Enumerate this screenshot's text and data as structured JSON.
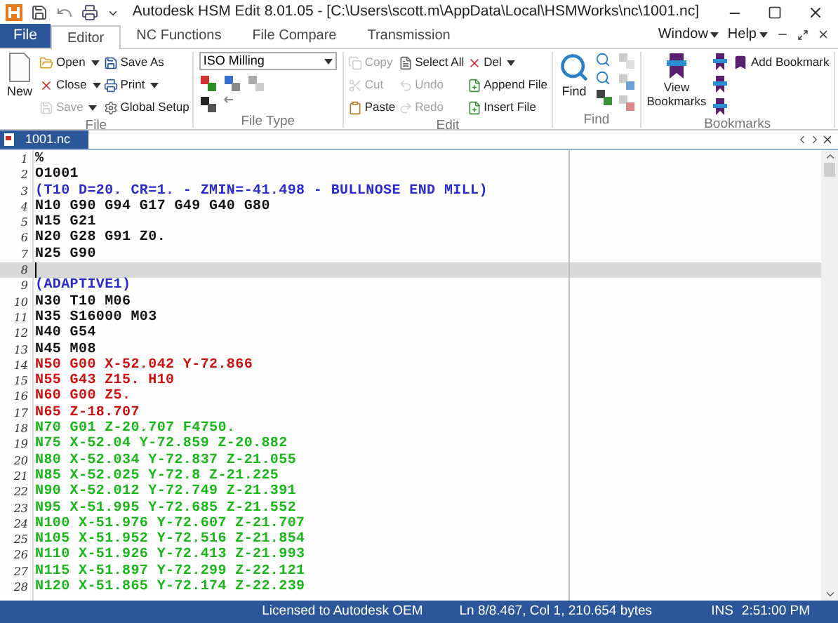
{
  "window": {
    "title": "Autodesk HSM Edit 8.01.05 - [C:\\Users\\scott.m\\AppData\\Local\\HSMWorks\\nc\\1001.nc]"
  },
  "ribbon_tabs": [
    {
      "label": "File",
      "kind": "file",
      "selected": false
    },
    {
      "label": "Editor",
      "kind": "tab",
      "selected": true
    },
    {
      "label": "NC Functions",
      "kind": "tab",
      "selected": false
    },
    {
      "label": "File Compare",
      "kind": "tab",
      "selected": false
    },
    {
      "label": "Transmission",
      "kind": "tab",
      "selected": false
    }
  ],
  "menus": [
    {
      "label": "Window"
    },
    {
      "label": "Help"
    }
  ],
  "file_group": {
    "label": "File",
    "new_button": "New",
    "columns": [
      [
        {
          "label": "Open",
          "dropdown": true,
          "disabled": false
        },
        {
          "label": "Close",
          "dropdown": true,
          "disabled": false
        },
        {
          "label": "Save",
          "dropdown": true,
          "disabled": true
        }
      ],
      [
        {
          "label": "Save As",
          "dropdown": false,
          "disabled": false
        },
        {
          "label": "Print",
          "dropdown": true,
          "disabled": false
        },
        {
          "label": "Global Setup",
          "dropdown": false,
          "disabled": false
        }
      ]
    ]
  },
  "file_type_group": {
    "label": "File Type",
    "combo_value": "ISO Milling"
  },
  "edit_group": {
    "label": "Edit",
    "columns": [
      [
        {
          "label": "Copy",
          "dropdown": false,
          "disabled": true
        },
        {
          "label": "Cut",
          "dropdown": false,
          "disabled": true
        },
        {
          "label": "Paste",
          "dropdown": false,
          "disabled": false
        }
      ],
      [
        {
          "label": "Select All",
          "dropdown": false,
          "disabled": false
        },
        {
          "label": "Undo",
          "dropdown": false,
          "disabled": true
        },
        {
          "label": "Redo",
          "dropdown": false,
          "disabled": true
        }
      ],
      [
        {
          "label": "Del",
          "dropdown": true,
          "disabled": false
        },
        {
          "label": "Append File",
          "dropdown": false,
          "disabled": false
        },
        {
          "label": "Insert File",
          "dropdown": false,
          "disabled": false
        }
      ]
    ]
  },
  "find_group": {
    "label": "Find",
    "find_button": "Find"
  },
  "bookmarks_group": {
    "label": "Bookmarks",
    "view_button": "View Bookmarks",
    "add_button": "Add Bookmark"
  },
  "document_tabs": [
    {
      "label": "1001.nc",
      "selected": true
    }
  ],
  "editor": {
    "lines": [
      {
        "number": "1",
        "text": "%",
        "kind": "plain",
        "current": false
      },
      {
        "number": "2",
        "text": "O1001",
        "kind": "plain",
        "current": false
      },
      {
        "number": "3",
        "text": "(T10 D=20. CR=1. - ZMIN=-41.498 - BULLNOSE END MILL)",
        "kind": "comment",
        "current": false
      },
      {
        "number": "4",
        "text": "N10 G90 G94 G17 G49 G40 G80",
        "kind": "plain",
        "current": false
      },
      {
        "number": "5",
        "text": "N15 G21",
        "kind": "plain",
        "current": false
      },
      {
        "number": "6",
        "text": "N20 G28 G91 Z0.",
        "kind": "plain",
        "current": false
      },
      {
        "number": "7",
        "text": "N25 G90",
        "kind": "plain",
        "current": false
      },
      {
        "number": "8",
        "current": true
      },
      {
        "number": "9",
        "text": "(ADAPTIVE1)",
        "kind": "comment",
        "current": false
      },
      {
        "number": "10",
        "text": "N30 T10 M06",
        "kind": "plain",
        "current": false
      },
      {
        "number": "11",
        "text": "N35 S16000 M03",
        "kind": "plain",
        "current": false
      },
      {
        "number": "12",
        "text": "N40 G54",
        "kind": "plain",
        "current": false
      },
      {
        "number": "13",
        "text": "N45 M08",
        "kind": "plain",
        "current": false
      },
      {
        "number": "14",
        "text": "N50 G00 X-52.042 Y-72.866",
        "kind": "rapid",
        "current": false
      },
      {
        "number": "15",
        "text": "N55 G43 Z15. H10",
        "kind": "rapid",
        "current": false
      },
      {
        "number": "16",
        "text": "N60 G00 Z5.",
        "kind": "rapid",
        "current": false
      },
      {
        "number": "17",
        "text": "N65 Z-18.707",
        "kind": "rapid",
        "current": false
      },
      {
        "number": "18",
        "text": "N70 G01 Z-20.707 F4750.",
        "kind": "feed",
        "current": false
      },
      {
        "number": "19",
        "text": "N75 X-52.04 Y-72.859 Z-20.882",
        "kind": "feed",
        "current": false
      },
      {
        "number": "20",
        "text": "N80 X-52.034 Y-72.837 Z-21.055",
        "kind": "feed",
        "current": false
      },
      {
        "number": "21",
        "text": "N85 X-52.025 Y-72.8 Z-21.225",
        "kind": "feed",
        "current": false
      },
      {
        "number": "22",
        "text": "N90 X-52.012 Y-72.749 Z-21.391",
        "kind": "feed",
        "current": false
      },
      {
        "number": "23",
        "text": "N95 X-51.995 Y-72.685 Z-21.552",
        "kind": "feed",
        "current": false
      },
      {
        "number": "24",
        "text": "N100 X-51.976 Y-72.607 Z-21.707",
        "kind": "feed",
        "current": false
      },
      {
        "number": "25",
        "text": "N105 X-51.952 Y-72.516 Z-21.854",
        "kind": "feed",
        "current": false
      },
      {
        "number": "26",
        "text": "N110 X-51.926 Y-72.413 Z-21.993",
        "kind": "feed",
        "current": false
      },
      {
        "number": "27",
        "text": "N115 X-51.897 Y-72.299 Z-22.121",
        "kind": "feed",
        "current": false
      },
      {
        "number": "28",
        "text": "N120 X-51.865 Y-72.174 Z-22.239",
        "kind": "feed",
        "current": false
      }
    ]
  },
  "status_bar": [
    "Licensed to Autodesk OEM",
    "Ln 8/8.467, Col 1, 210.654 bytes",
    "INS",
    "2:51:00 PM"
  ]
}
